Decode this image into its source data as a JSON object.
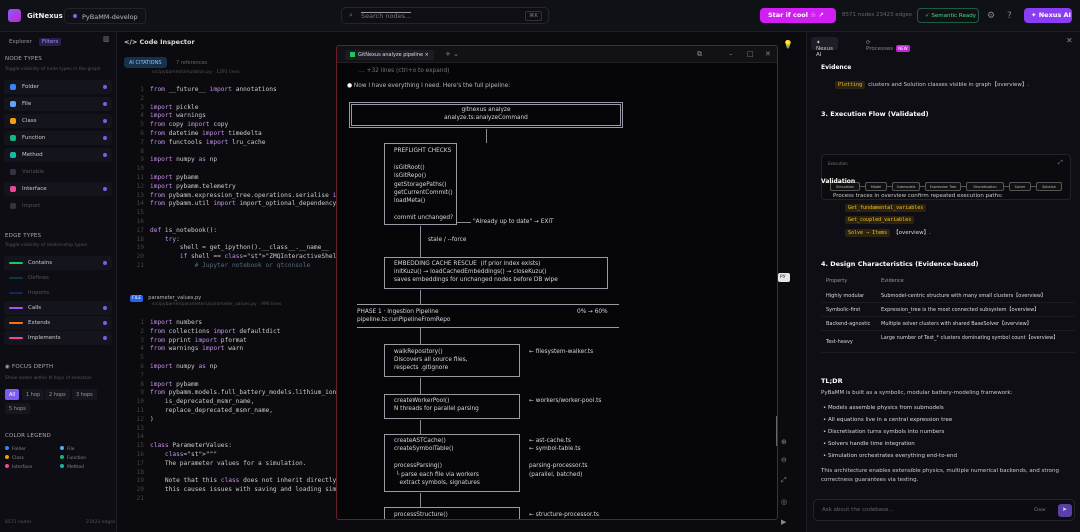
{
  "app": {
    "name": "GitNexus",
    "repo": "PyBaMM-develop"
  },
  "search": {
    "placeholder": "Search nodes...",
    "shortcut": "⌘K"
  },
  "topbar": {
    "star_label": "Star if cool ☆ ↗",
    "stats": [
      "8571 nodes",
      "23423 edges"
    ],
    "semantic": "Semantic Ready",
    "nexus_ai": "Nexus AI"
  },
  "left": {
    "tabs": [
      "Explorer",
      "Filters"
    ],
    "node_types_title": "NODE TYPES",
    "node_types_sub": "Toggle visibility of node types in the graph",
    "node_types": [
      {
        "label": "Folder",
        "color": "#3b82f6",
        "on": true
      },
      {
        "label": "File",
        "color": "#60a5fa",
        "on": true
      },
      {
        "label": "Class",
        "color": "#f59e0b",
        "on": true
      },
      {
        "label": "Function",
        "color": "#10b981",
        "on": true
      },
      {
        "label": "Method",
        "color": "#14b8a6",
        "on": true
      },
      {
        "label": "Variable",
        "color": "#64748b",
        "on": false
      },
      {
        "label": "Interface",
        "color": "#ec4899",
        "on": true
      },
      {
        "label": "Import",
        "color": "#6b7280",
        "on": false
      }
    ],
    "edge_types_title": "EDGE TYPES",
    "edge_types_sub": "Toggle visibility of relationship types",
    "edge_types": [
      {
        "label": "Contains",
        "color": "#22c55e",
        "on": true
      },
      {
        "label": "Defines",
        "color": "#0e7490",
        "on": false
      },
      {
        "label": "Imports",
        "color": "#1d4ed8",
        "on": false
      },
      {
        "label": "Calls",
        "color": "#a855f7",
        "on": true
      },
      {
        "label": "Extends",
        "color": "#f97316",
        "on": true
      },
      {
        "label": "Implements",
        "color": "#ec4899",
        "on": true
      }
    ],
    "focus_title": "FOCUS DEPTH",
    "focus_sub": "Show nodes within N hops of selection",
    "hops": [
      "All",
      "1 hop",
      "2 hops",
      "3 hops",
      "5 hops"
    ],
    "legend_title": "COLOR LEGEND",
    "legend": [
      {
        "label": "Folder",
        "color": "#3b82f6"
      },
      {
        "label": "File",
        "color": "#60a5fa"
      },
      {
        "label": "Class",
        "color": "#f59e0b"
      },
      {
        "label": "Function",
        "color": "#10b981"
      },
      {
        "label": "Interface",
        "color": "#ec4899"
      },
      {
        "label": "Method",
        "color": "#14b8a6"
      }
    ],
    "footer": [
      "8571 nodes",
      "23423 edges"
    ]
  },
  "code": {
    "title": "Code Inspector",
    "ai_citations": "AI CITATIONS",
    "refs": "7 references",
    "file1_path": "src/pybamm/simulation.py · 1291 lines",
    "lines1": [
      [
        "1",
        "from __future__ import annotations"
      ],
      [
        "2",
        ""
      ],
      [
        "3",
        "import pickle"
      ],
      [
        "4",
        "import warnings"
      ],
      [
        "5",
        "from copy import copy"
      ],
      [
        "6",
        "from datetime import timedelta"
      ],
      [
        "7",
        "from functools import lru_cache"
      ],
      [
        "8",
        ""
      ],
      [
        "9",
        "import numpy as np"
      ],
      [
        "10",
        ""
      ],
      [
        "11",
        "import pybamm"
      ],
      [
        "12",
        "import pybamm.telemetry"
      ],
      [
        "13",
        "from pybamm.expression_tree.operations.serialise import Serialise"
      ],
      [
        "14",
        "from pybamm.util import import_optional_dependency"
      ],
      [
        "15",
        ""
      ],
      [
        "16",
        ""
      ],
      [
        "17",
        "def is_notebook():"
      ],
      [
        "18",
        "    try:"
      ],
      [
        "19",
        "        shell = get_ipython().__class__.__name__"
      ],
      [
        "20",
        "        if shell == \"ZMQInteractiveShell\":  # pragma: no cover"
      ],
      [
        "21",
        "            # Jupyter notebook or qtconsole"
      ]
    ],
    "file2_badge": "FILE",
    "file2_name": "parameter_values.py",
    "file2_path": "src/pybamm/parameters/parameter_values.py · 996 lines",
    "lines2": [
      [
        "1",
        "import numbers"
      ],
      [
        "2",
        "from collections import defaultdict"
      ],
      [
        "3",
        "from pprint import pformat"
      ],
      [
        "4",
        "from warnings import warn"
      ],
      [
        "5",
        ""
      ],
      [
        "6",
        "import numpy as np"
      ],
      [
        "7",
        ""
      ],
      [
        "8",
        "import pybamm"
      ],
      [
        "9",
        "from pybamm.models.full_battery_models.lithium_ion.msmr import ("
      ],
      [
        "10",
        "    is_deprecated_msmr_name,"
      ],
      [
        "11",
        "    replace_deprecated_msmr_name,"
      ],
      [
        "12",
        ")"
      ],
      [
        "13",
        ""
      ],
      [
        "14",
        ""
      ],
      [
        "15",
        "class ParameterValues:"
      ],
      [
        "16",
        "    \"\"\""
      ],
      [
        "17",
        "    The parameter values for a simulation."
      ],
      [
        "18",
        ""
      ],
      [
        "19",
        "    Note that this class does not inherit directly from the python dictionary"
      ],
      [
        "20",
        "    this causes issues with saving and loading simulations."
      ],
      [
        "21",
        ""
      ]
    ]
  },
  "terminal": {
    "tab": "GitNexus analyze pipeline",
    "hidden": "… +32 lines (ctrl+o to expand)",
    "intro": "Now I have everything I need. Here's the full pipeline:",
    "title_box": [
      "gitnexus analyze",
      "analyze.ts:analyzeCommand"
    ],
    "preflight": [
      "PREFLIGHT CHECKS",
      "",
      "isGitRoot()",
      "isGitRepo()",
      "getStoragePaths()",
      "getCurrentCommit()",
      "loadMeta()",
      "",
      "commit unchanged?"
    ],
    "up_to_date": "\"Already up to date\" → EXIT",
    "stale": "stale / --force",
    "cache": [
      "EMBEDDING CACHE RESCUE  (if prior index exists)",
      "initKuzu() → loadCachedEmbeddings() → closeKuzu()",
      "saves embeddings for unchanged nodes before DB wipe"
    ],
    "phase": [
      "PHASE 1 · Ingestion Pipeline",
      "pipeline.ts:runPipelineFromRepo"
    ],
    "phase_pct": "0% → 60%",
    "walk": [
      "walkRepository()",
      "Discovers all source files,",
      "respects .gitignore"
    ],
    "walk_ref": "← filesystem-walker.ts",
    "worker": [
      "createWorkerPool()",
      "N threads for parallel parsing"
    ],
    "worker_ref": "← workers/worker-pool.ts",
    "ast": [
      "createASTCache()",
      "createSymbolTable()",
      "",
      "processParsing()",
      " └ parse each file via workers",
      "   extract symbols, signatures"
    ],
    "ast_refs": [
      "← ast-cache.ts",
      "← symbol-table.ts",
      "",
      "parsing-processor.ts",
      "(parallel, batched)"
    ],
    "structure": "processStructure()",
    "structure_ref": "← structure-processor.ts"
  },
  "right": {
    "tabs": [
      "Nexus AI",
      "Processes"
    ],
    "new_badge": "NEW",
    "evidence_title": "Evidence",
    "evidence_text": "clusters and Solution classes visible in graph【overview】.",
    "evidence_pill": "Plotting",
    "exec_title": "3. Execution Flow (Validated)",
    "flow_label": "Execution",
    "flow_nodes": [
      "Simulation",
      "Model",
      "Submodels",
      "Expression Tree",
      "Discretisation",
      "Solver",
      "Solution"
    ],
    "validation_title": "Validation",
    "validation_text": "Process traces in overview confirm repeated execution paths:",
    "validation_items": [
      "Get_fundamental_variables",
      "Get_coupled_variables",
      "Solve → Items"
    ],
    "validation_suffix": "【overview】.",
    "design_title": "4. Design Characteristics (Evidence-based)",
    "table_head": [
      "Property",
      "Evidence"
    ],
    "table_rows": [
      [
        "Highly modular",
        "Submodel-centric structure with many small clusters【overview】"
      ],
      [
        "Symbolic-first",
        "Expression_tree is the most connected subsystem【overview】"
      ],
      [
        "Backend-agnostic",
        "Multiple solver clusters with shared BaseSolver【overview】"
      ],
      [
        "Test-heavy",
        "Large number of  Test_*  clusters dominating symbol count【overview】"
      ]
    ],
    "tldr_title": "TL;DR",
    "tldr_lead": "PyBaMM is built as a symbolic, modular battery-modeling framework:",
    "tldr_items": [
      "Models assemble physics from submodels",
      "All equations live in a central expression tree",
      "Discretisation turns symbols into numbers",
      "Solvers handle time integration",
      "Simulation orchestrates everything end-to-end"
    ],
    "tldr_end": "This architecture enables extensible physics, multiple numerical backends, and strong correctness guarantees via testing.",
    "input_placeholder": "Ask about the codebase...",
    "clear": "Clear",
    "send": "➤"
  },
  "badge_py": "py"
}
